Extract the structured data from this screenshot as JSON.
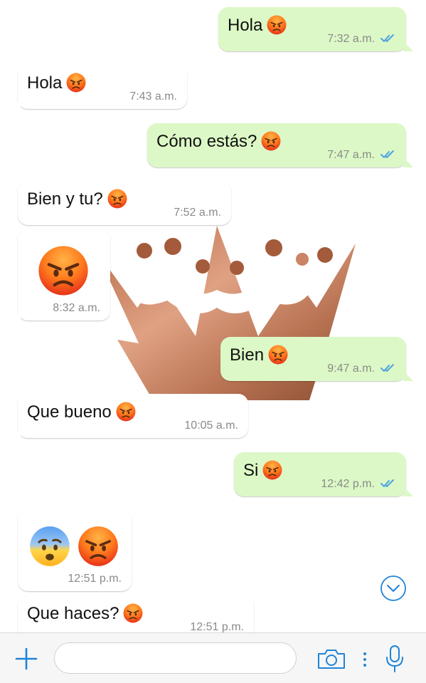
{
  "messages": [
    {
      "side": "out",
      "text": "Hola",
      "emojis": [
        "angry"
      ],
      "time": "7:32 a.m.",
      "read": true
    },
    {
      "side": "in",
      "text": "Hola",
      "emojis": [
        "angry"
      ],
      "time": "7:43 a.m."
    },
    {
      "side": "out",
      "text": "Cómo estás?",
      "emojis": [
        "angry"
      ],
      "time": "7:47 a.m.",
      "read": true
    },
    {
      "side": "in",
      "text": "Bien y tu?",
      "emojis": [
        "angry"
      ],
      "time": "7:52 a.m."
    },
    {
      "side": "in",
      "text": "",
      "emojis": [
        "angry"
      ],
      "time": "8:32 a.m."
    },
    {
      "side": "out",
      "text": "Bien",
      "emojis": [
        "angry"
      ],
      "time": "9:47 a.m.",
      "read": true
    },
    {
      "side": "in",
      "text": "Que bueno",
      "emojis": [
        "angry"
      ],
      "time": "10:05 a.m."
    },
    {
      "side": "out",
      "text": "Si",
      "emojis": [
        "angry"
      ],
      "time": "12:42 p.m.",
      "read": true
    },
    {
      "side": "in",
      "text": "",
      "emojis": [
        "anxious",
        "angry"
      ],
      "time": "12:51 p.m."
    },
    {
      "side": "in",
      "text": "Que haces?",
      "emojis": [
        "angry"
      ],
      "time": "12:51 p.m."
    }
  ],
  "icons": {
    "angry_emoji": "angry-face-icon",
    "anxious_emoji": "anxious-face-icon",
    "read_receipt": "double-check-icon",
    "scroll_down": "chevron-down-circle-icon",
    "attach": "plus-icon",
    "camera": "camera-icon",
    "menu": "vertical-dots-icon",
    "mic": "microphone-icon",
    "background": "crown-watermark"
  },
  "composer": {
    "placeholder": ""
  },
  "colors": {
    "incoming": "#ffffff",
    "outgoing": "#dcf8c6",
    "accent": "#1e84d8",
    "read_ticks": "#4fa3e0"
  }
}
